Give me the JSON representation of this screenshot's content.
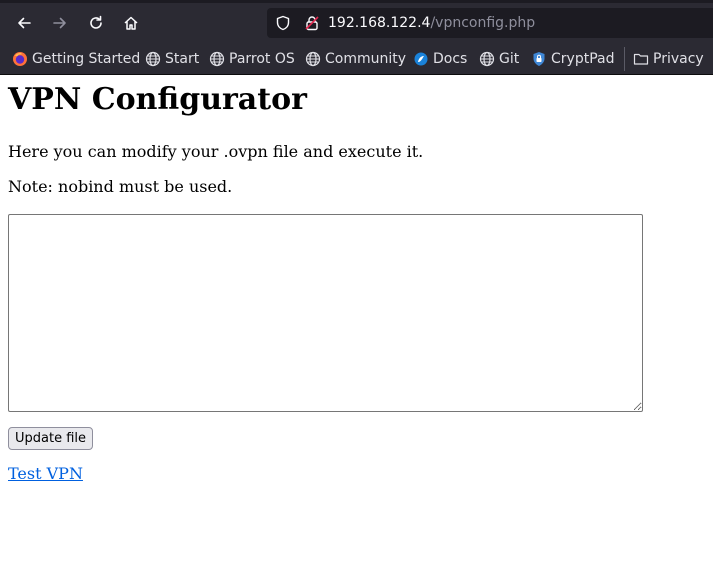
{
  "browser": {
    "url_host": "192.168.122.4",
    "url_path": "/vpnconfig.php",
    "bookmarks": [
      {
        "label": "Getting Started",
        "icon": "firefox-icon"
      },
      {
        "label": "Start",
        "icon": "globe-icon"
      },
      {
        "label": "Parrot OS",
        "icon": "globe-icon"
      },
      {
        "label": "Community",
        "icon": "globe-icon"
      },
      {
        "label": "Docs",
        "icon": "docs-icon"
      },
      {
        "label": "Git",
        "icon": "globe-icon"
      },
      {
        "label": "CryptPad",
        "icon": "cryptpad-icon"
      },
      {
        "label": "Privacy",
        "icon": "folder-icon"
      }
    ]
  },
  "page": {
    "heading": "VPN Configurator",
    "description": "Here you can modify your .ovpn file and execute it.",
    "note": "Note: nobind must be used.",
    "textarea_value": "",
    "update_button_label": "Update file",
    "test_link_label": "Test VPN"
  }
}
